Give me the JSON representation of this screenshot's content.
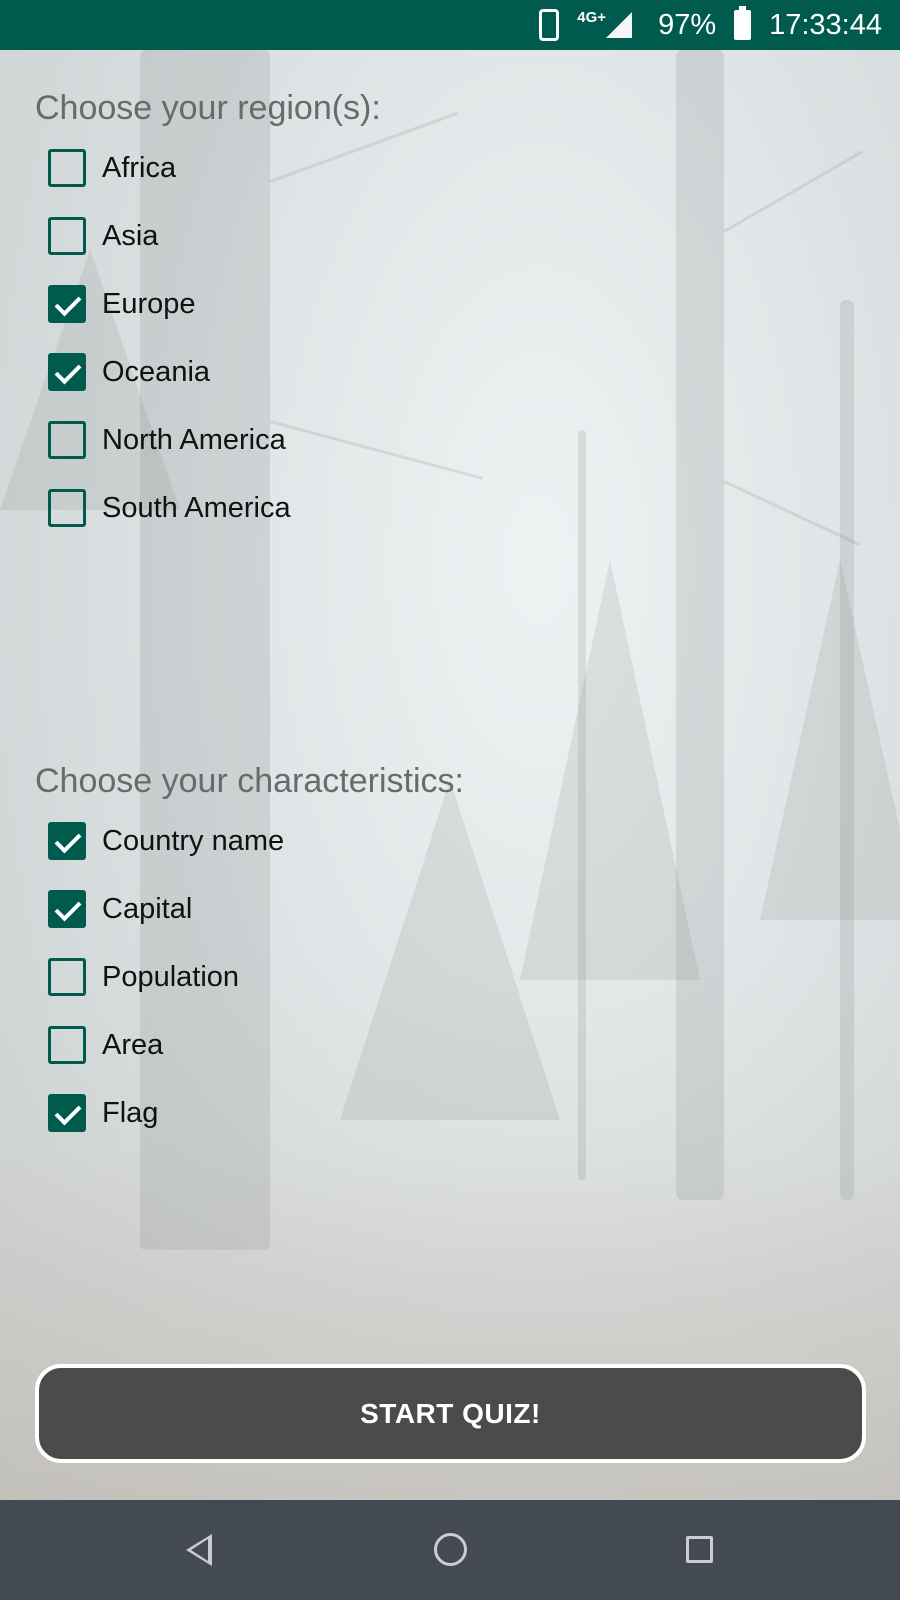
{
  "status_bar": {
    "network": "4G+",
    "battery": "97%",
    "time": "17:33:44"
  },
  "regions": {
    "title": "Choose your region(s):",
    "options": [
      {
        "label": "Africa",
        "checked": false
      },
      {
        "label": "Asia",
        "checked": false
      },
      {
        "label": "Europe",
        "checked": true
      },
      {
        "label": "Oceania",
        "checked": true
      },
      {
        "label": "North America",
        "checked": false
      },
      {
        "label": "South America",
        "checked": false
      }
    ]
  },
  "characteristics": {
    "title": "Choose your characteristics:",
    "options": [
      {
        "label": "Country name",
        "checked": true
      },
      {
        "label": "Capital",
        "checked": true
      },
      {
        "label": "Population",
        "checked": false
      },
      {
        "label": "Area",
        "checked": false
      },
      {
        "label": "Flag",
        "checked": true
      }
    ]
  },
  "start_button": {
    "label": "START QUIZ!"
  },
  "colors": {
    "accent": "#005a4e",
    "button_bg": "#4b4b4b",
    "nav_bar": "#434a51"
  },
  "nav_bar": {
    "back_icon": "back-triangle",
    "home_icon": "home-circle",
    "recents_icon": "recents-square"
  }
}
